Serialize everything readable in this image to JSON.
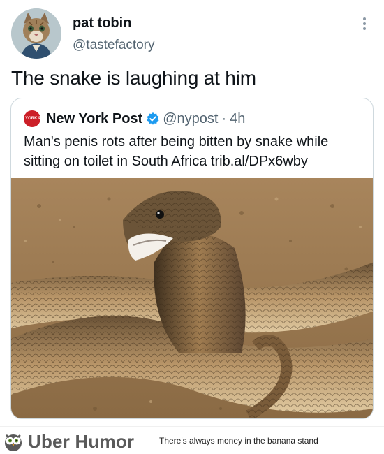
{
  "tweet": {
    "display_name": "pat tobin",
    "handle": "@tastefactory",
    "text": "The snake is laughing at him",
    "avatar_icon": "cat-avatar-icon",
    "more_icon": "more-options-icon"
  },
  "quoted_tweet": {
    "logo_text": "NEW YORK POST",
    "display_name": "New York Post",
    "verified_icon": "verified-badge-icon",
    "handle": "@nypost",
    "separator": "·",
    "time": "4h",
    "text": "Man's penis rots after being bitten by snake while sitting on toilet in South Africa trib.al/DPx6wby",
    "image_icon": "cobra-snake-photo"
  },
  "footer": {
    "brand": "Uber Humor",
    "tagline": "There's always money in the banana stand",
    "logo_icon": "owl-logo-icon"
  },
  "colors": {
    "primary_text": "#0f1419",
    "secondary_text": "#536471",
    "verified_blue": "#1d9bf0",
    "nyp_red": "#cc1f28",
    "border": "#cfd9de"
  }
}
